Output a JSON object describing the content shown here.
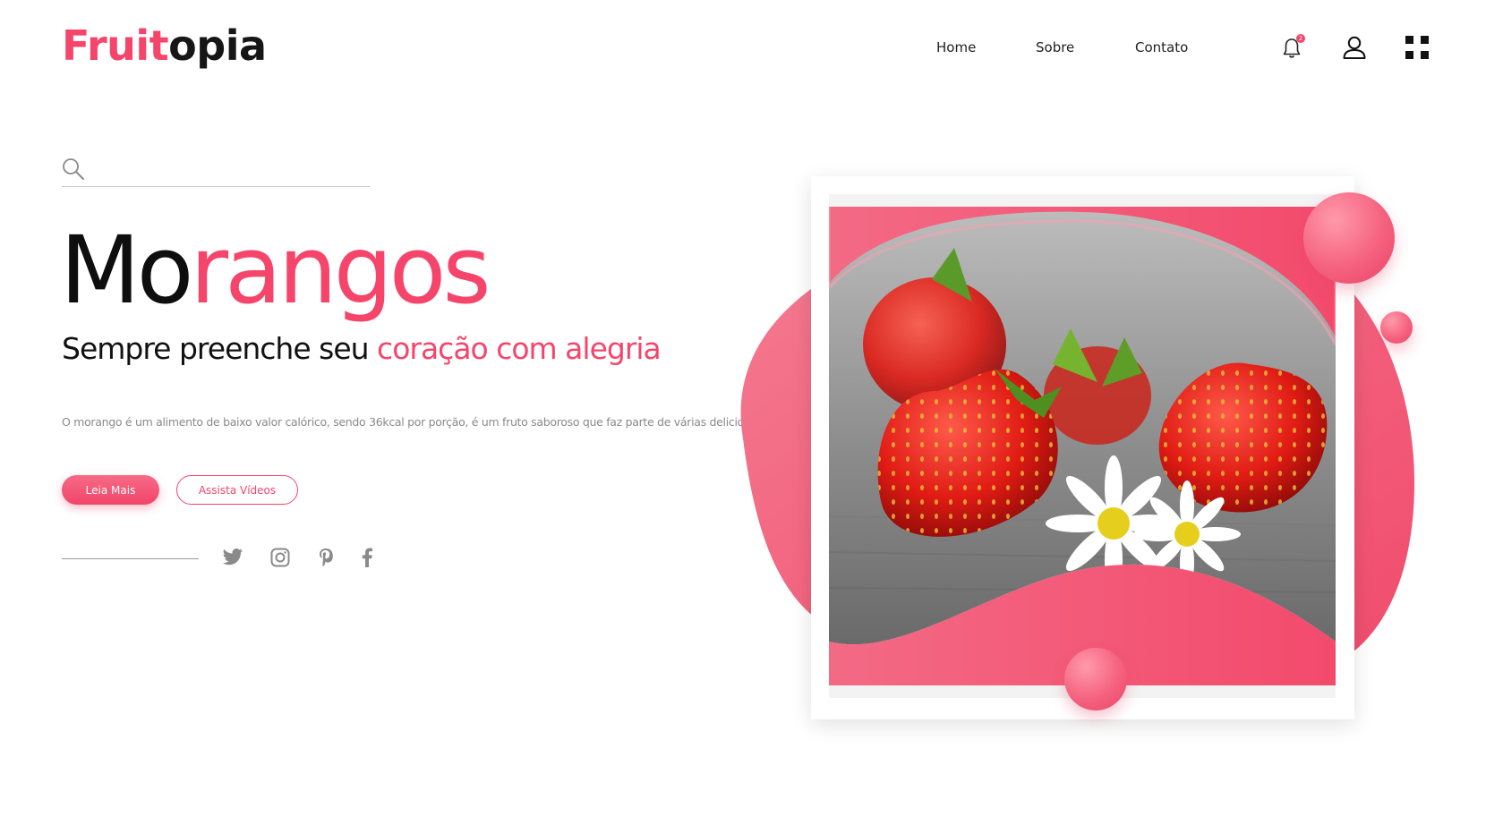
{
  "brand": {
    "part1": "Fruit",
    "part2": "opia"
  },
  "nav": {
    "items": [
      "Home",
      "Sobre",
      "Contato"
    ]
  },
  "notifications": {
    "count": "2"
  },
  "search": {
    "placeholder": "",
    "value": ""
  },
  "hero": {
    "title_part1": "Mo",
    "title_part2": "rangos",
    "subtitle_part1": "Sempre preenche seu ",
    "subtitle_part2": "coração com alegria",
    "description": "O morango é um alimento de baixo valor calórico, sendo 36kcal por porção, é um fruto saboroso que faz parte de várias deliciosas receitas."
  },
  "buttons": {
    "primary": "Leia Mais",
    "secondary": "Assista Vídeos"
  },
  "social": [
    "twitter-icon",
    "instagram-icon",
    "pinterest-icon",
    "facebook-icon"
  ],
  "colors": {
    "accent": "#f5456b",
    "text_dark": "#111111",
    "text_muted": "#8a8a8a"
  }
}
